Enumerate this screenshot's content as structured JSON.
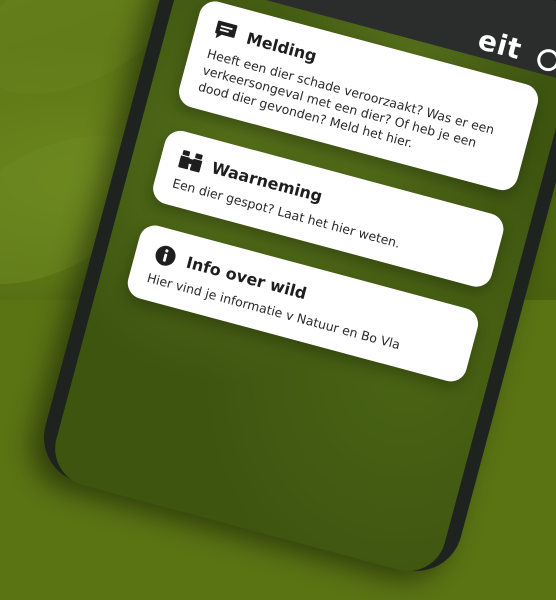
{
  "header": {
    "title": "eit"
  },
  "cards": [
    {
      "icon": "chat-bubble-icon",
      "title": "Melding",
      "text": "Heeft een dier schade veroorzaakt? Was er een verkeersongeval met een dier? Of heb je een dood dier gevonden? Meld het hier."
    },
    {
      "icon": "binoculars-icon",
      "title": "Waarneming",
      "text": "Een dier gespot? Laat het hier weten."
    },
    {
      "icon": "info-icon",
      "title": "Info over wild",
      "text": "Hier vind je informatie v Natuur en Bo Vla"
    }
  ],
  "colors": {
    "background_green": "#5a7414",
    "header_dark": "#2a2d2b",
    "card_white": "#ffffff",
    "text_dark": "#1e1e1e"
  }
}
